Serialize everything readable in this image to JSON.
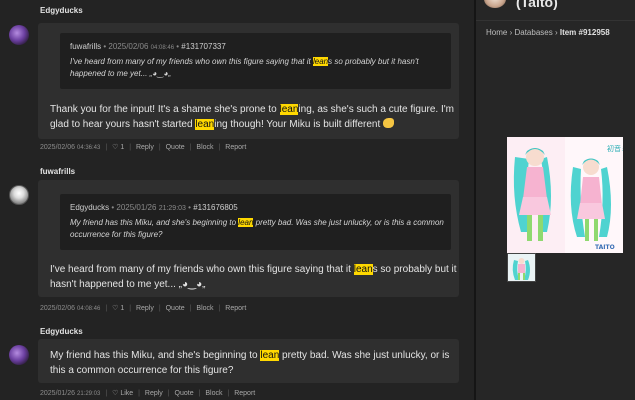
{
  "header": {
    "title": "(Taito)",
    "breadcrumb": {
      "home": "Home",
      "databases": "Databases",
      "item": "Item #912958"
    }
  },
  "posts": [
    {
      "author": "Edgyducks",
      "quote": {
        "author": "fuwafrills",
        "date": "2025/02/06",
        "time": "04:08:46",
        "id": "#131707337",
        "text_before": "I've heard from many of my friends who own this figure saying that it ",
        "highlight": "lean",
        "text_after": "s so probably but it hasn't happened to me yet... „◕‿◕„"
      },
      "text": {
        "p1": "Thank you for the input! It's a shame she's prone to ",
        "h1": "lean",
        "p2": "ing, as she's such a cute figure. I'm glad to hear yours hasn't started ",
        "h2": "lean",
        "p3": "ing though! Your Miku is built different "
      },
      "meta": {
        "date": "2025/02/06",
        "time": "04:36:43",
        "likes": "1",
        "reply": "Reply",
        "quote": "Quote",
        "block": "Block",
        "report": "Report"
      }
    },
    {
      "author": "fuwafrills",
      "quote": {
        "author": "Edgyducks",
        "date": "2025/01/26",
        "time": "21:29:03",
        "id": "#131676805",
        "text_before": "My friend has this Miku, and she's beginning to ",
        "highlight": "lean",
        "text_after": " pretty bad. Was she just unlucky, or is this a common occurrence for this figure?"
      },
      "text": {
        "p1": "I've heard from many of my friends who own this figure saying that it ",
        "h1": "lean",
        "p2": "s so probably but it hasn't happened to me yet... „◕‿◕„"
      },
      "meta": {
        "date": "2025/02/06",
        "time": "04:08:46",
        "likes": "1",
        "reply": "Reply",
        "quote": "Quote",
        "block": "Block",
        "report": "Report"
      }
    },
    {
      "author": "Edgyducks",
      "text": {
        "p1": "My friend has this Miku, and she's beginning to ",
        "h1": "lean",
        "p2": " pretty bad. Was she just unlucky, or is this a common occurrence for this figure?"
      },
      "meta": {
        "date": "2025/01/26",
        "time": "21:29:03",
        "like": "Like",
        "reply": "Reply",
        "quote": "Quote",
        "block": "Block",
        "report": "Report"
      }
    }
  ],
  "images": {
    "main": "hatsune-miku-figure-box",
    "thumb": "hatsune-miku-figure-thumbnail",
    "logo_text": "初音ミク",
    "brand_text": "TAITO"
  },
  "colors": {
    "highlight": "#ffd800",
    "bubble": "#2f2f2f",
    "quote": "#1f1f1f",
    "background": "#232323"
  }
}
